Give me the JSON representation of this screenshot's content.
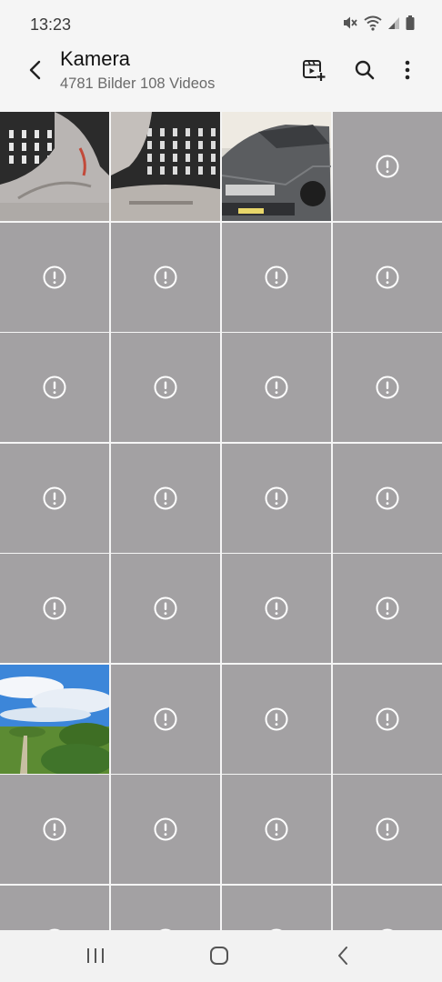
{
  "status_bar": {
    "time": "13:23",
    "icons": [
      "mute-icon",
      "wifi-icon",
      "signal-icon",
      "battery-icon"
    ]
  },
  "app_bar": {
    "title": "Kamera",
    "subtitle": "4781 Bilder 108 Videos",
    "back_icon": "back-arrow-icon",
    "actions": [
      "create-video-icon",
      "search-icon",
      "more-options-icon"
    ]
  },
  "grid": {
    "columns": 4,
    "tiles": [
      "photo-metal-part-1",
      "photo-metal-part-2",
      "photo-car",
      "error",
      "error",
      "error",
      "error",
      "error",
      "error",
      "error",
      "error",
      "error",
      "error",
      "error",
      "error",
      "error",
      "error",
      "error",
      "error",
      "error",
      "photo-landscape",
      "error",
      "error",
      "error",
      "error",
      "error",
      "error",
      "error",
      "error",
      "error",
      "error",
      "error"
    ]
  },
  "colors": {
    "background": "#f5f5f5",
    "placeholder_tile": "#a3a1a3",
    "text_primary": "#111111",
    "text_secondary": "#6a6a6a"
  },
  "nav_bar": {
    "buttons": [
      "recent-apps-icon",
      "home-icon",
      "back-icon"
    ]
  }
}
